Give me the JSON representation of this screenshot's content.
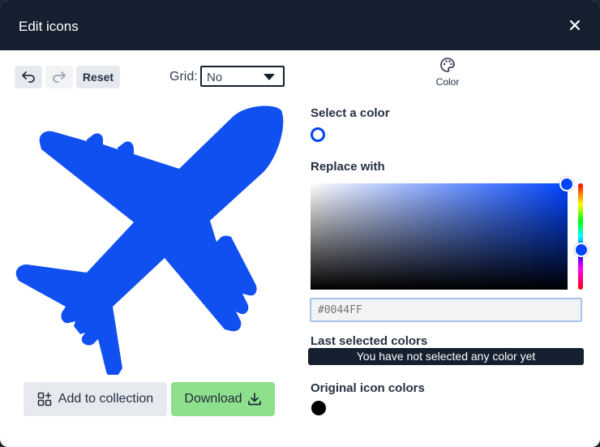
{
  "header": {
    "title": "Edit icons",
    "close_icon": "close-icon"
  },
  "toolbar": {
    "undo_icon": "undo-icon",
    "redo_icon": "redo-icon",
    "reset_label": "Reset",
    "grid_label": "Grid:",
    "grid_value": "No"
  },
  "preview": {
    "icon": "airplane-icon",
    "fill_color": "#1150F0"
  },
  "actions": {
    "add_label": "Add to collection",
    "download_label": "Download"
  },
  "color_panel": {
    "tab_label": "Color",
    "select_heading": "Select a color",
    "selected_color": "#0044FF",
    "replace_heading": "Replace with",
    "hex_placeholder": "#0044FF",
    "last_heading": "Last selected colors",
    "last_empty_text": "You have not selected any color yet",
    "original_heading": "Original icon colors",
    "original_colors": [
      "#000000"
    ]
  },
  "colors": {
    "header_bg": "#14202F",
    "accent": "#0044FF",
    "download_bg": "#8FE08D"
  }
}
